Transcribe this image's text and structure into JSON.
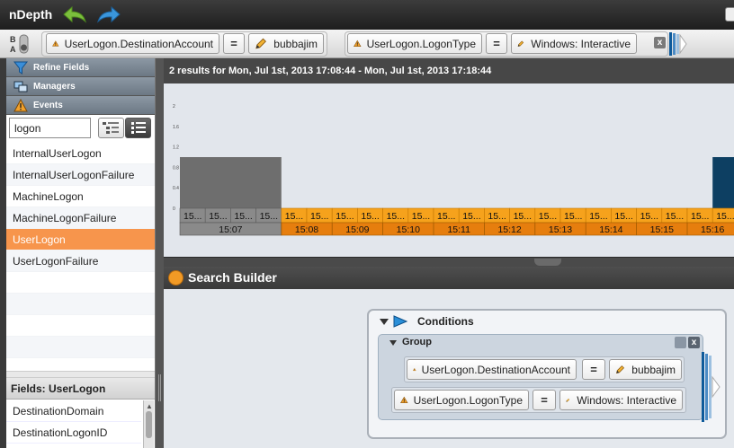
{
  "app": {
    "title": "nDepth"
  },
  "filter_bar": {
    "filters": [
      {
        "field": "UserLogon.DestinationAccount",
        "operator": "=",
        "value": "bubbajim"
      },
      {
        "field": "UserLogon.LogonType",
        "operator": "=",
        "value": "Windows: Interactive"
      }
    ],
    "close_label": "x"
  },
  "sidebar": {
    "sections": [
      "Refine Fields",
      "Managers",
      "Events"
    ],
    "search_value": "logon",
    "events": [
      "InternalUserLogon",
      "InternalUserLogonFailure",
      "MachineLogon",
      "MachineLogonFailure",
      "UserLogon",
      "UserLogonFailure"
    ],
    "selected_event": "UserLogon",
    "fields_header": "Fields: UserLogon",
    "fields": [
      "DestinationDomain",
      "DestinationLogonID"
    ]
  },
  "results": {
    "summary": "2 results for Mon, Jul 1st, 2013 17:08:44 - Mon, Jul 1st, 2013 17:18:44"
  },
  "chart_data": {
    "type": "bar",
    "y_ticks": [
      "2",
      "1.6",
      "1.2",
      "0.8",
      "0.4",
      "0"
    ],
    "ylim": [
      0,
      2
    ],
    "minute_labels": [
      "15:07",
      "15:08",
      "15:09",
      "15:10",
      "15:11",
      "15:12",
      "15:13",
      "15:14",
      "15:15",
      "15:16",
      "15"
    ],
    "slot_label": "15...",
    "slot_label_short": "15",
    "bars": [
      {
        "slot_start": 0,
        "slot_end": 4,
        "value": 1,
        "color": "#6e6e6e"
      },
      {
        "slot_start": 21,
        "slot_end": 22,
        "value": 1,
        "color": "#0d3f62"
      }
    ],
    "colors": {
      "before": "#8a8a8a",
      "range": "#f6a21c",
      "range_dark": "#e67e0e",
      "plot_bg": "#e2e6ec"
    }
  },
  "search_builder": {
    "title": "Search Builder",
    "conditions_label": "Conditions",
    "group_label": "Group",
    "conditions": [
      {
        "field": "UserLogon.DestinationAccount",
        "operator": "=",
        "value": "bubbajim"
      },
      {
        "field": "UserLogon.LogonType",
        "operator": "=",
        "value": "Windows: Interactive"
      }
    ],
    "close_label": "x"
  },
  "icons": {
    "back": "back-arrow-icon",
    "forward": "forward-arrow-icon",
    "warning": "warning-icon",
    "pencil": "pencil-icon",
    "filter": "filter-funnel-icon",
    "managers": "managers-icon",
    "events": "events-warning-icon",
    "tree_view": "tree-view-icon",
    "list_view": "list-view-icon"
  }
}
